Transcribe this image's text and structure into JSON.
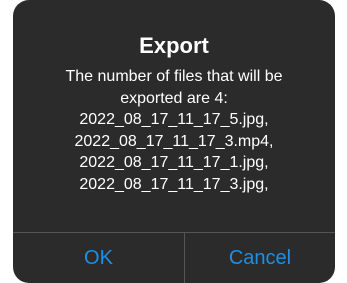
{
  "dialog": {
    "title": "Export",
    "message_lines": [
      "The number of files that will be",
      "exported are 4:",
      "2022_08_17_11_17_5.jpg,",
      "2022_08_17_11_17_3.mp4,",
      "2022_08_17_11_17_1.jpg,",
      "2022_08_17_11_17_3.jpg,"
    ],
    "ok_label": "OK",
    "cancel_label": "Cancel"
  },
  "colors": {
    "dialog_background": "#2b2b2b",
    "text": "#ffffff",
    "button_text": "#1e8fe1",
    "divider": "#555555"
  }
}
